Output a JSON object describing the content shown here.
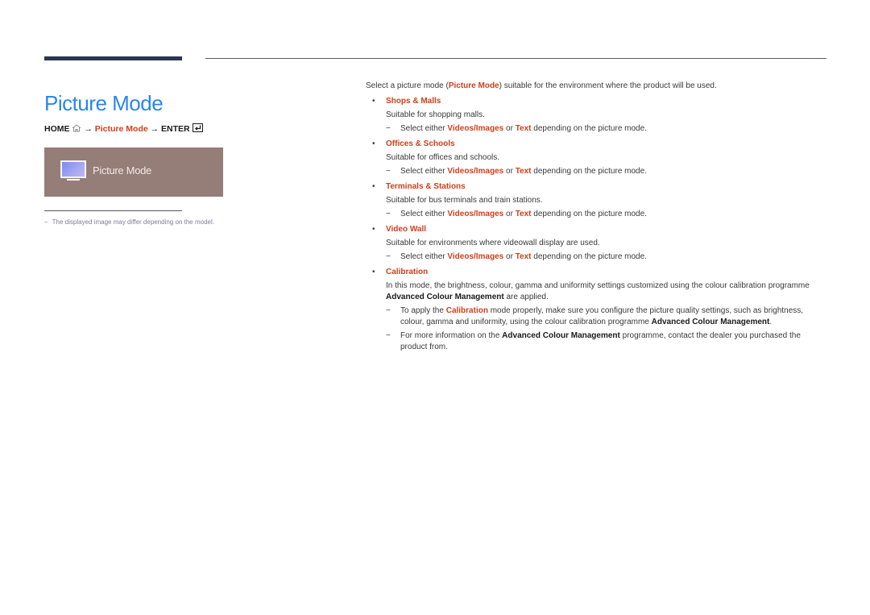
{
  "page": {
    "title": "Picture Mode",
    "breadcrumb": {
      "home_label": "HOME",
      "home_icon": "home-icon",
      "arrow1": "→",
      "menu_item": "Picture Mode",
      "arrow2": "→",
      "enter_label": "ENTER",
      "enter_icon": "enter-icon"
    },
    "osd_preview": {
      "icon": "tv-monitor-icon",
      "label": "Picture Mode"
    },
    "note": {
      "dash": "−",
      "text": "The displayed image may differ depending on the model."
    }
  },
  "content": {
    "intro": {
      "before": "Select a picture mode (",
      "highlight": "Picture Mode",
      "after": ") suitable for the environment where the product will be used."
    },
    "items": [
      {
        "bullet": "•",
        "title": "Shops & Malls",
        "desc": "Suitable for shopping malls.",
        "sub": {
          "dash": "−",
          "pre": "Select either ",
          "h1": "Videos/Images",
          "mid": " or ",
          "h2": "Text",
          "post": " depending on the picture mode."
        }
      },
      {
        "bullet": "•",
        "title": "Offices & Schools",
        "desc": "Suitable for offices and schools.",
        "sub": {
          "dash": "−",
          "pre": "Select either ",
          "h1": "Videos/Images",
          "mid": " or ",
          "h2": "Text",
          "post": " depending on the picture mode."
        }
      },
      {
        "bullet": "•",
        "title": "Terminals & Stations",
        "desc": "Suitable for bus terminals and train stations.",
        "sub": {
          "dash": "−",
          "pre": "Select either ",
          "h1": "Videos/Images",
          "mid": " or ",
          "h2": "Text",
          "post": " depending on the picture mode."
        }
      },
      {
        "bullet": "•",
        "title": "Video Wall",
        "desc": "Suitable for environments where videowall display are used.",
        "sub": {
          "dash": "−",
          "pre": "Select either ",
          "h1": "Videos/Images",
          "mid": " or ",
          "h2": "Text",
          "post": " depending on the picture mode."
        }
      }
    ],
    "calibration": {
      "bullet": "•",
      "title": "Calibration",
      "desc_pre": "In this mode, the brightness, colour, gamma and uniformity settings customized using the colour calibration programme ",
      "desc_bold": "Advanced Colour Management",
      "desc_post": " are applied.",
      "sub1": {
        "dash": "−",
        "pre": "To apply the ",
        "highlight": "Calibration",
        "mid": " mode properly, make sure you configure the picture quality settings, such as brightness, colour, gamma and uniformity, using the colour calibration programme ",
        "bold": "Advanced Colour Management",
        "post": "."
      },
      "sub2": {
        "dash": "−",
        "pre": "For more information on the ",
        "bold": "Advanced Colour Management",
        "post": " programme, contact the dealer you purchased the product from."
      }
    }
  }
}
